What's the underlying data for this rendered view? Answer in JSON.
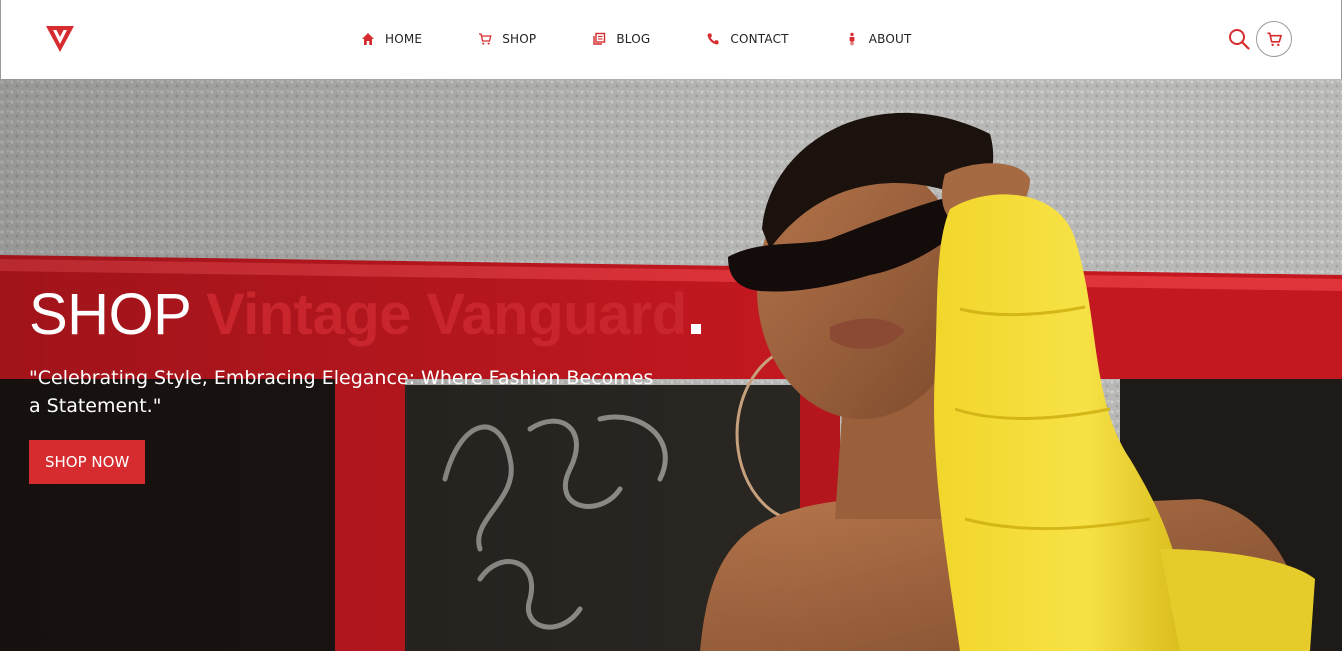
{
  "brand": {
    "logo_icon": "v-triangle-logo",
    "accent_color": "#d62c2f"
  },
  "nav": {
    "items": [
      {
        "label": "HOME",
        "icon": "home-icon"
      },
      {
        "label": "SHOP",
        "icon": "cart-icon"
      },
      {
        "label": "BLOG",
        "icon": "blog-icon"
      },
      {
        "label": "CONTACT",
        "icon": "phone-icon"
      },
      {
        "label": "ABOUT",
        "icon": "person-icon"
      }
    ]
  },
  "header_actions": {
    "search_icon": "search-icon",
    "cart_icon": "cart-icon"
  },
  "hero": {
    "headline_prefix": "SHOP",
    "headline_accent": "Vintage Vanguard",
    "tagline": "\"Celebrating Style, Embracing Elegance: Where Fashion Becomes a Statement.\"",
    "cta_label": "SHOP NOW",
    "text_color": "#ffffff",
    "accent_color": "#c9252c"
  }
}
